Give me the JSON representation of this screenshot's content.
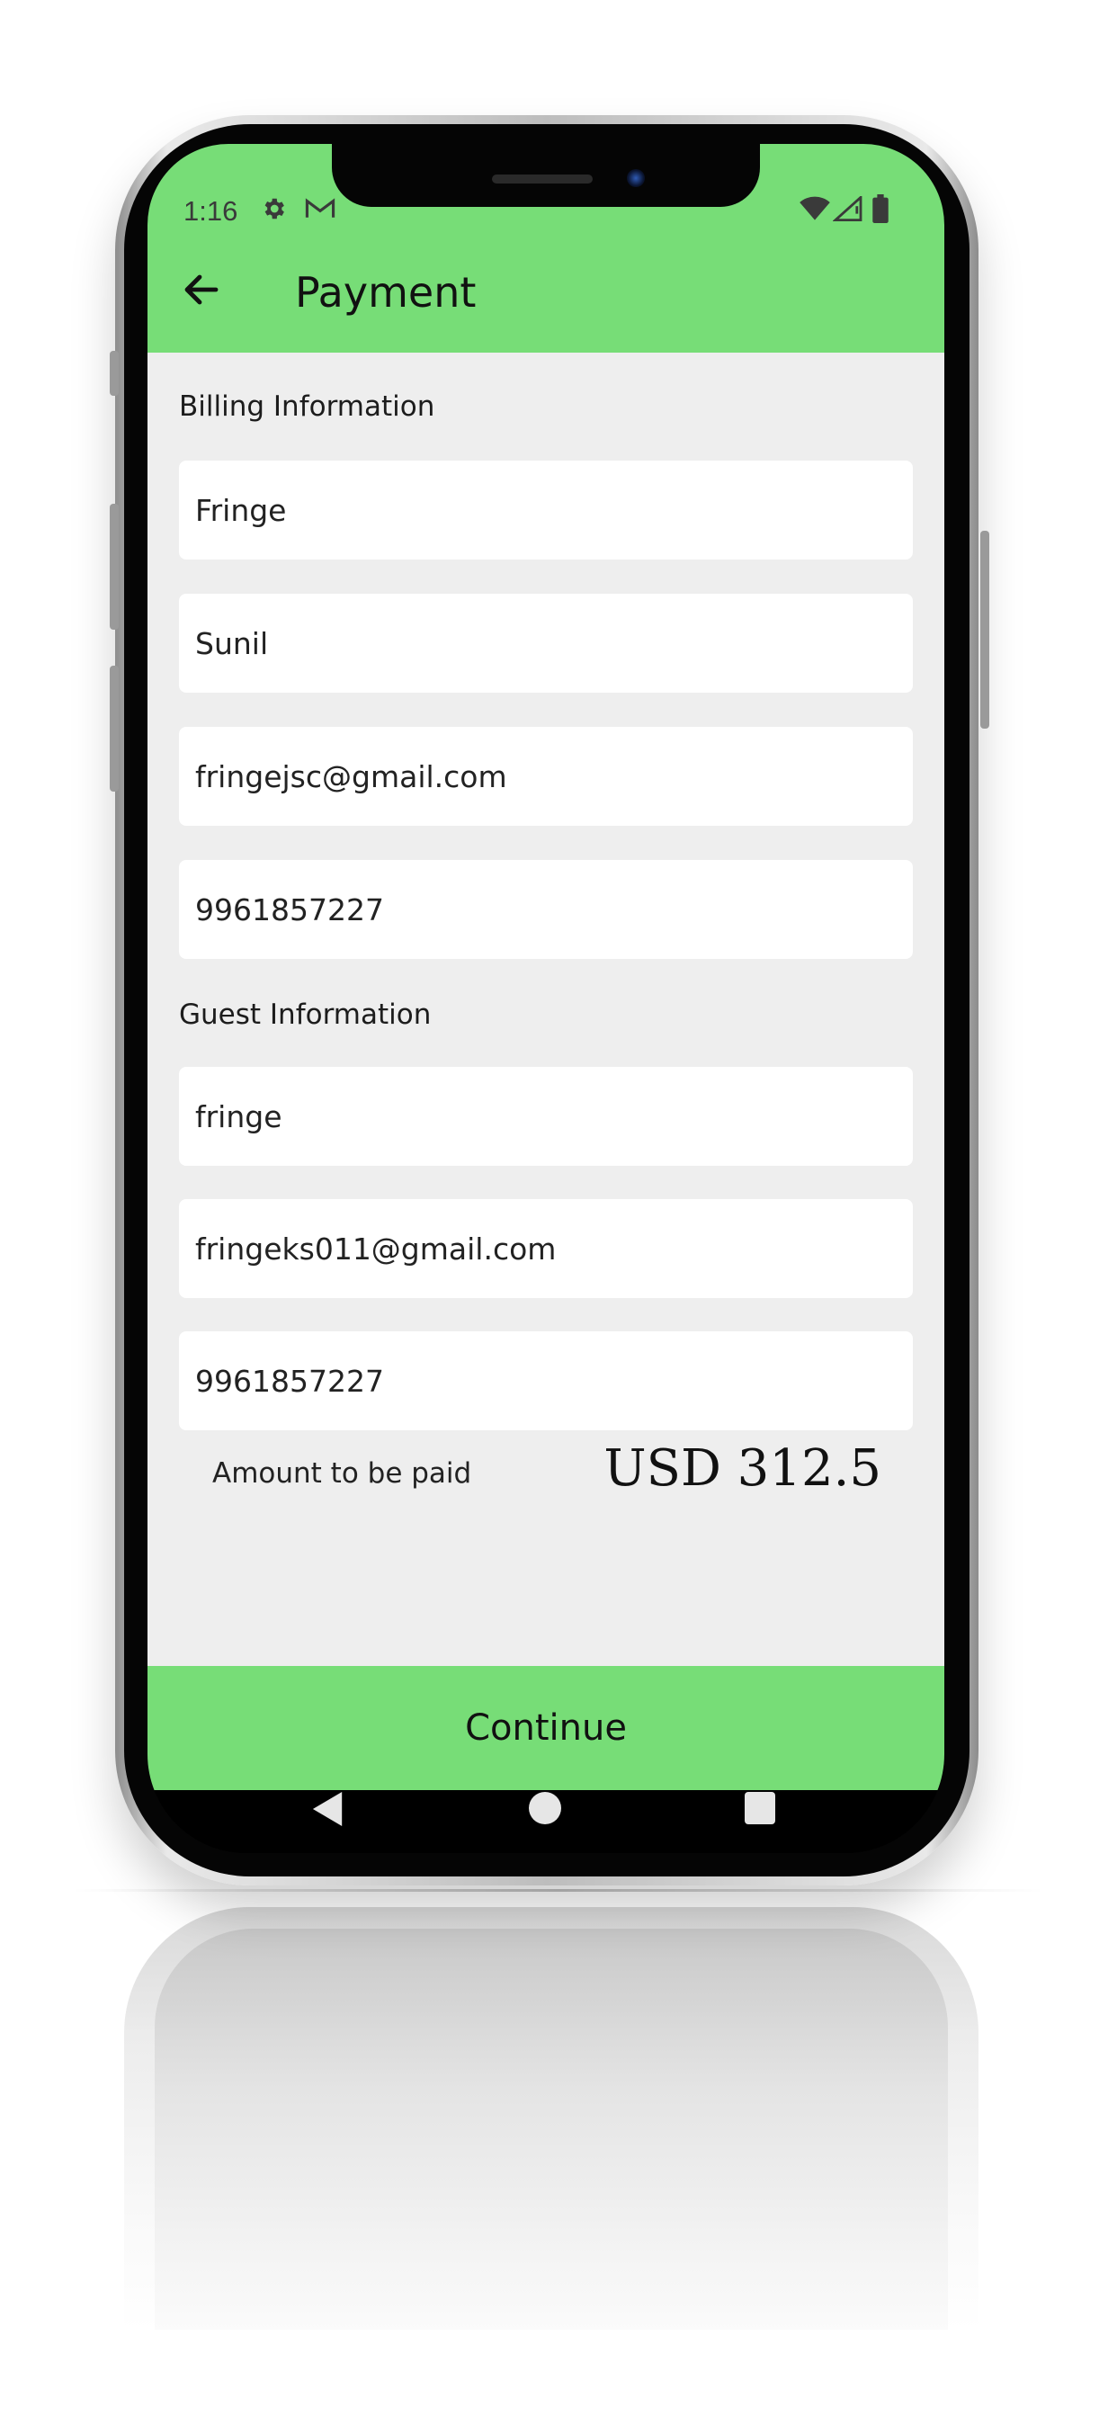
{
  "status_bar": {
    "time": "1:16",
    "icons": [
      "gear-icon",
      "gmail-icon",
      "wifi-icon",
      "signal-icon",
      "battery-icon"
    ]
  },
  "header": {
    "title": "Payment",
    "back_icon": "arrow-left-icon",
    "background_color": "#77DD77"
  },
  "billing": {
    "label": "Billing Information",
    "first_name": "Fringe",
    "last_name": "Sunil",
    "email": "fringejsc@gmail.com",
    "phone": "9961857227"
  },
  "guest": {
    "label": "Guest Information",
    "name": "fringe",
    "email": "fringeks011@gmail.com",
    "phone": "9961857227"
  },
  "amount": {
    "label": "Amount to be paid",
    "value": "USD 312.5"
  },
  "footer": {
    "continue_label": "Continue",
    "background_color": "#77DD77"
  },
  "nav_bar": {
    "icons": [
      "nav-back-icon",
      "nav-home-icon",
      "nav-recents-icon"
    ]
  }
}
